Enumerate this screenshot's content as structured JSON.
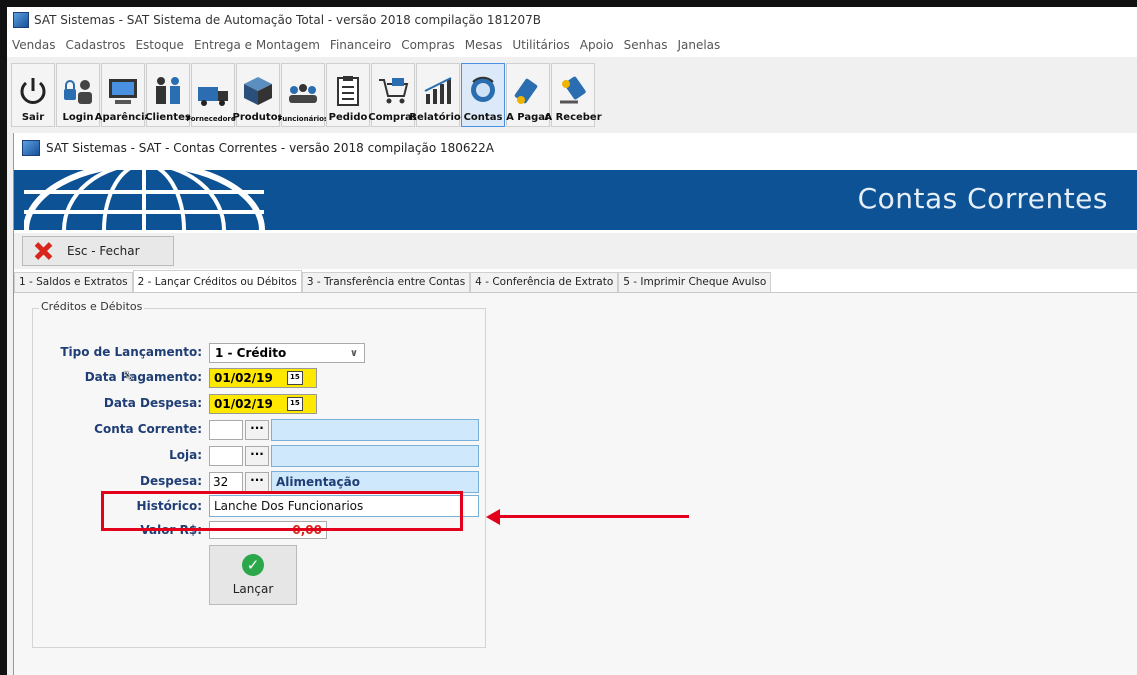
{
  "window": {
    "title": "SAT Sistemas - SAT Sistema de Automação Total - versão 2018 compilação 181207B"
  },
  "menu": [
    "Vendas",
    "Cadastros",
    "Estoque",
    "Entrega e Montagem",
    "Financeiro",
    "Compras",
    "Mesas",
    "Utilitários",
    "Apoio",
    "Senhas",
    "Janelas"
  ],
  "toolbar": {
    "items": [
      {
        "label": "Sair",
        "icon": "power-icon"
      },
      {
        "label": "Login",
        "icon": "login-icon"
      },
      {
        "label": "Aparência",
        "icon": "monitor-icon"
      },
      {
        "label": "Clientes",
        "icon": "clients-icon"
      },
      {
        "label": "Fornecedores",
        "icon": "truck-icon"
      },
      {
        "label": "Produtos",
        "icon": "boxes-icon"
      },
      {
        "label": "Funcionários",
        "icon": "employees-icon"
      },
      {
        "label": "Pedido",
        "icon": "clipboard-icon"
      },
      {
        "label": "Compras",
        "icon": "cart-icon"
      },
      {
        "label": "Relatórios",
        "icon": "chart-icon"
      },
      {
        "label": "Contas",
        "icon": "coins-icon"
      },
      {
        "label": "A Pagar",
        "icon": "pay-icon"
      },
      {
        "label": "A Receber",
        "icon": "receive-icon"
      }
    ]
  },
  "child": {
    "title": "SAT Sistemas - SAT - Contas Correntes - versão 2018 compilação 180622A",
    "banner_title": "Contas Correntes",
    "close_label": "Esc - Fechar"
  },
  "tabs": [
    "1 - Saldos e Extratos",
    "2 - Lançar Créditos ou Débitos",
    "3 - Transferência entre Contas",
    "4 - Conferência de Extrato",
    "5 - Imprimir Cheque Avulso"
  ],
  "form": {
    "group_label": "Créditos e Débitos",
    "tipo_label": "Tipo de Lançamento:",
    "tipo_value": "1 - Crédito",
    "data_pagamento_label": "Data Pagamento:",
    "data_pagamento_value": "01/02/19",
    "data_despesa_label": "Data Despesa:",
    "data_despesa_value": "01/02/19",
    "conta_label": "Conta Corrente:",
    "loja_label": "Loja:",
    "despesa_label": "Despesa:",
    "despesa_code": "32",
    "despesa_name": "Alimentação",
    "historico_label": "Histórico:",
    "historico_value": "Lanche Dos Funcionarios",
    "valor_label": "Valor R$:",
    "valor_value": "0,00",
    "lancar_label": "Lançar",
    "ellipsis": "···",
    "calendar_glyph": "15"
  },
  "colors": {
    "banner": "#0d5294",
    "highlight": "#e2001a",
    "date_bg": "#ffe800",
    "lookup_bg": "#cfe8fb"
  }
}
